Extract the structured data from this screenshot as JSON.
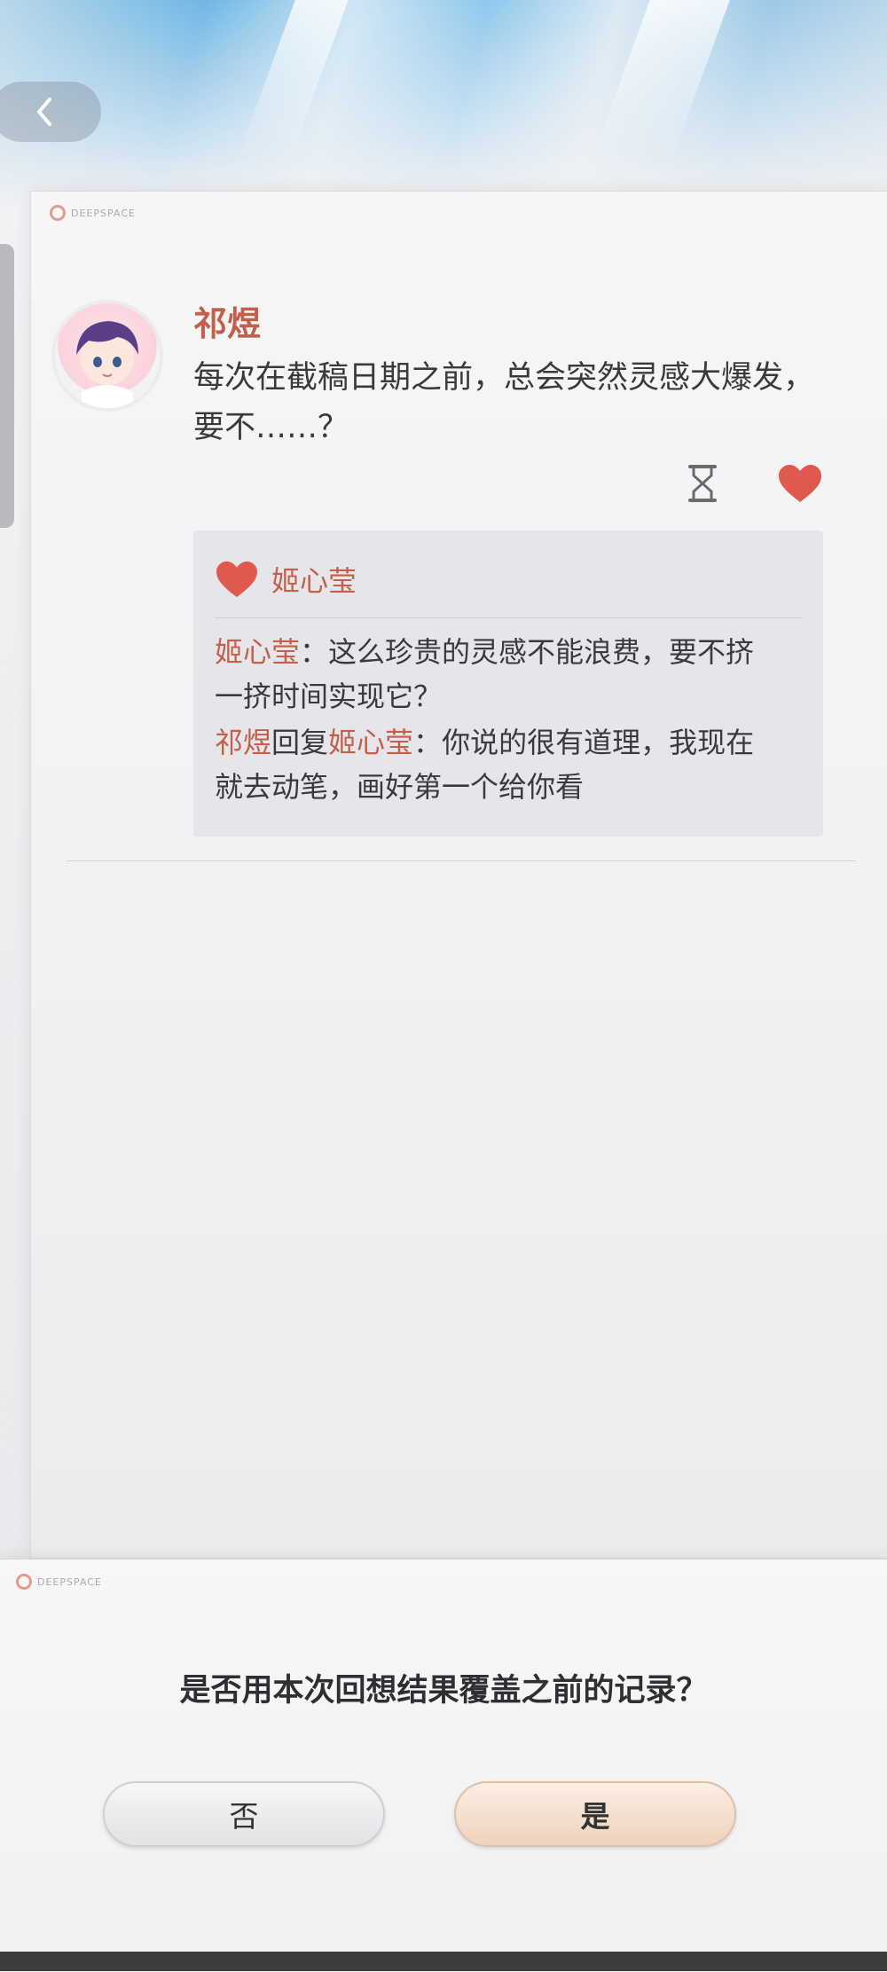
{
  "brand": {
    "text": "DEEPSPACE"
  },
  "nav": {
    "back_icon": "chevron-left-icon"
  },
  "post": {
    "author": "祁煜",
    "text": "每次在截稿日期之前，总会突然灵感大爆发，要不……？",
    "actions": {
      "hourglass_icon": "hourglass-icon",
      "like_icon": "heart-icon"
    },
    "likes": {
      "names": [
        "姬心莹"
      ]
    },
    "comments": [
      {
        "author": "姬心莹",
        "sep": "：",
        "text": "这么珍贵的灵感不能浪费，要不挤一挤时间实现它？"
      },
      {
        "author": "祁煜",
        "reply_word": "回复",
        "reply_to": "姬心莹",
        "sep": "：",
        "text": "你说的很有道理，我现在就去动笔，画好第一个给你看"
      }
    ]
  },
  "dialog": {
    "question": "是否用本次回想结果覆盖之前的记录？",
    "no_label": "否",
    "yes_label": "是"
  },
  "colors": {
    "accent": "#c2604c",
    "heart": "#e0584e"
  }
}
